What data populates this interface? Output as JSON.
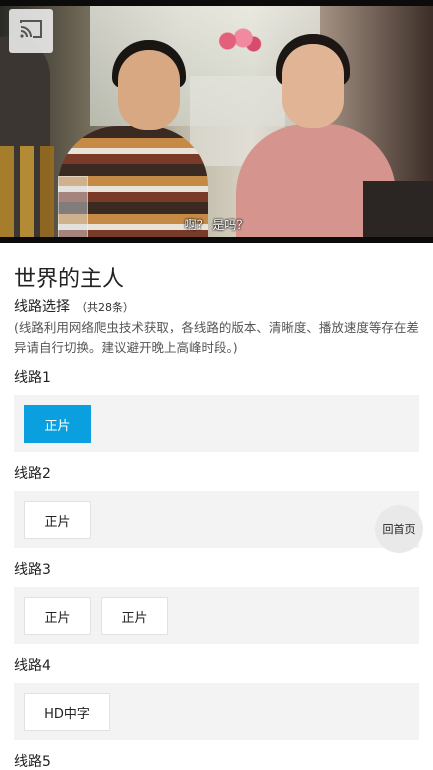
{
  "video": {
    "subtitle": "啊？ 是吗？",
    "cast_icon": "cast-icon"
  },
  "movie": {
    "title": "世界的主人"
  },
  "routes_section": {
    "heading": "线路选择",
    "count": "（共28条）",
    "notice": "(线路利用网络爬虫技术获取，各线路的版本、清晰度、播放速度等存在差异请自行切换。建议避开晚上高峰时段。)"
  },
  "routes": [
    {
      "label": "线路1",
      "episodes": [
        "正片"
      ],
      "active_index": 0
    },
    {
      "label": "线路2",
      "episodes": [
        "正片"
      ]
    },
    {
      "label": "线路3",
      "episodes": [
        "正片",
        "正片"
      ]
    },
    {
      "label": "线路4",
      "episodes": [
        "HD中字"
      ]
    },
    {
      "label": "线路5",
      "episodes": []
    }
  ],
  "float": {
    "home_label": "回首页"
  },
  "colors": {
    "accent": "#0aa0df",
    "box_bg": "#f3f3f3"
  }
}
